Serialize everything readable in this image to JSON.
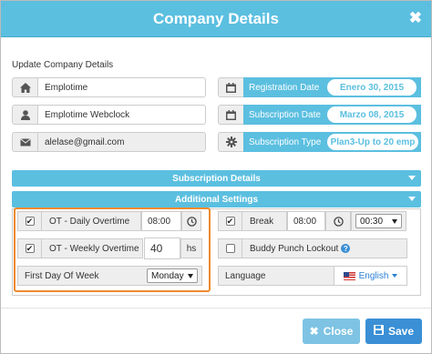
{
  "dialog": {
    "title": "Company Details",
    "close_glyph": "✖"
  },
  "update_section": {
    "title": "Update Company Details",
    "company_name": "Emplotime",
    "company_alias": "Emplotime Webclock",
    "email": "alelase@gmail.com",
    "icons": [
      "home-icon",
      "user-icon",
      "envelope-icon"
    ]
  },
  "dates": {
    "registration_label": "Registration Date",
    "registration_value": "Enero 30, 2015",
    "subscription_label": "Subscription Date",
    "subscription_value": "Marzo 08, 2015",
    "type_label": "Subscription Type",
    "type_value": "Plan3-Up to 20 emp"
  },
  "bars": {
    "subscription_details": "Subscription Details",
    "additional_settings": "Additional Settings"
  },
  "settings": {
    "daily_overtime_label": "OT - Daily Overtime",
    "daily_overtime_value": "08:00",
    "weekly_overtime_label": "OT - Weekly Overtime",
    "weekly_overtime_value": "40",
    "weekly_overtime_unit": "hs",
    "first_day_label": "First Day Of Week",
    "first_day_value": "Monday",
    "break_label": "Break",
    "break_time": "08:00",
    "break_duration": "00:30",
    "buddy_punch_label": "Buddy Punch Lockout",
    "language_label": "Language",
    "language_value": "English",
    "daily_overtime_checked": true,
    "weekly_overtime_checked": true,
    "break_checked": true,
    "buddy_punch_checked": false
  },
  "buttons": {
    "close": "Close",
    "save": "Save"
  },
  "colors": {
    "accent": "#5bbfe0",
    "primary": "#3a8fd5",
    "highlight": "#ee8a2d"
  }
}
